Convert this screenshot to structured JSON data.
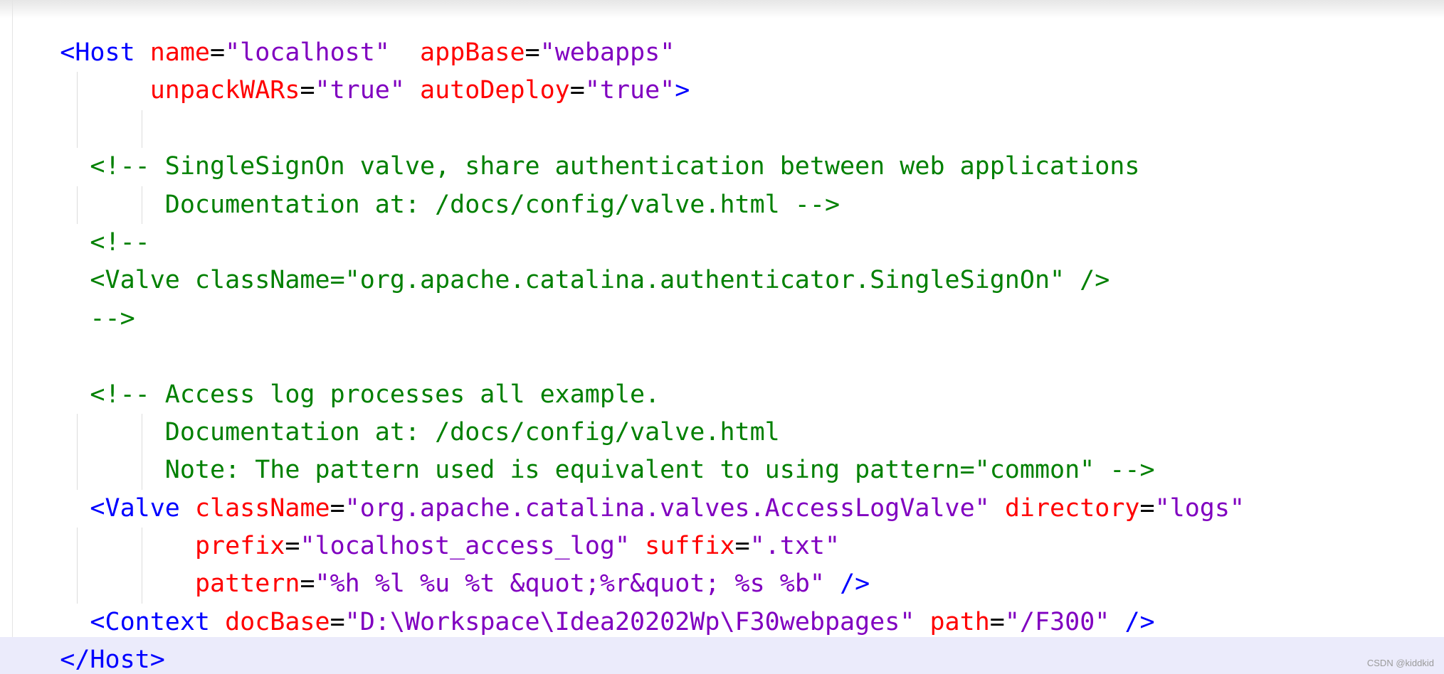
{
  "editor": {
    "lines": [
      [
        {
          "k": "t",
          "s": "    <Host "
        },
        {
          "k": "a",
          "s": "name"
        },
        {
          "k": "p",
          "s": "="
        },
        {
          "k": "v",
          "s": "\"localhost\""
        },
        {
          "k": "p",
          "s": "  "
        },
        {
          "k": "a",
          "s": "appBase"
        },
        {
          "k": "p",
          "s": "="
        },
        {
          "k": "v",
          "s": "\"webapps\""
        }
      ],
      [
        {
          "k": "p",
          "s": "          "
        },
        {
          "k": "a",
          "s": "unpackWARs"
        },
        {
          "k": "p",
          "s": "="
        },
        {
          "k": "v",
          "s": "\"true\""
        },
        {
          "k": "p",
          "s": " "
        },
        {
          "k": "a",
          "s": "autoDeploy"
        },
        {
          "k": "p",
          "s": "="
        },
        {
          "k": "v",
          "s": "\"true\""
        },
        {
          "k": "t",
          "s": ">"
        }
      ],
      [],
      [
        {
          "k": "c",
          "s": "      <!-- SingleSignOn valve, share authentication between web applications"
        }
      ],
      [
        {
          "k": "c",
          "s": "           Documentation at: /docs/config/valve.html -->"
        }
      ],
      [
        {
          "k": "c",
          "s": "      <!--"
        }
      ],
      [
        {
          "k": "c",
          "s": "      <Valve className=\"org.apache.catalina.authenticator.SingleSignOn\" />"
        }
      ],
      [
        {
          "k": "c",
          "s": "      -->"
        }
      ],
      [],
      [
        {
          "k": "c",
          "s": "      <!-- Access log processes all example."
        }
      ],
      [
        {
          "k": "c",
          "s": "           Documentation at: /docs/config/valve.html"
        }
      ],
      [
        {
          "k": "c",
          "s": "           Note: The pattern used is equivalent to using pattern=\"common\" -->"
        }
      ],
      [
        {
          "k": "t",
          "s": "      <Valve "
        },
        {
          "k": "a",
          "s": "className"
        },
        {
          "k": "p",
          "s": "="
        },
        {
          "k": "v",
          "s": "\"org.apache.catalina.valves.AccessLogValve\""
        },
        {
          "k": "p",
          "s": " "
        },
        {
          "k": "a",
          "s": "directory"
        },
        {
          "k": "p",
          "s": "="
        },
        {
          "k": "v",
          "s": "\"logs\""
        }
      ],
      [
        {
          "k": "p",
          "s": "             "
        },
        {
          "k": "a",
          "s": "prefix"
        },
        {
          "k": "p",
          "s": "="
        },
        {
          "k": "v",
          "s": "\"localhost_access_log\""
        },
        {
          "k": "p",
          "s": " "
        },
        {
          "k": "a",
          "s": "suffix"
        },
        {
          "k": "p",
          "s": "="
        },
        {
          "k": "v",
          "s": "\".txt\""
        }
      ],
      [
        {
          "k": "p",
          "s": "             "
        },
        {
          "k": "a",
          "s": "pattern"
        },
        {
          "k": "p",
          "s": "="
        },
        {
          "k": "v",
          "s": "\"%h %l %u %t &quot;%r&quot; %s %b\""
        },
        {
          "k": "p",
          "s": " "
        },
        {
          "k": "t",
          "s": "/>"
        }
      ],
      [
        {
          "k": "t",
          "s": "      <Context "
        },
        {
          "k": "a",
          "s": "docBase"
        },
        {
          "k": "p",
          "s": "="
        },
        {
          "k": "v",
          "s": "\"D:\\Workspace\\Idea20202Wp\\F30webpages\""
        },
        {
          "k": "p",
          "s": " "
        },
        {
          "k": "a",
          "s": "path"
        },
        {
          "k": "p",
          "s": "="
        },
        {
          "k": "v",
          "s": "\"/F300\""
        },
        {
          "k": "p",
          "s": " "
        },
        {
          "k": "t",
          "s": "/>"
        }
      ],
      [
        {
          "k": "t",
          "s": "    </Host>"
        }
      ]
    ]
  },
  "watermark": "CSDN @kiddkid"
}
